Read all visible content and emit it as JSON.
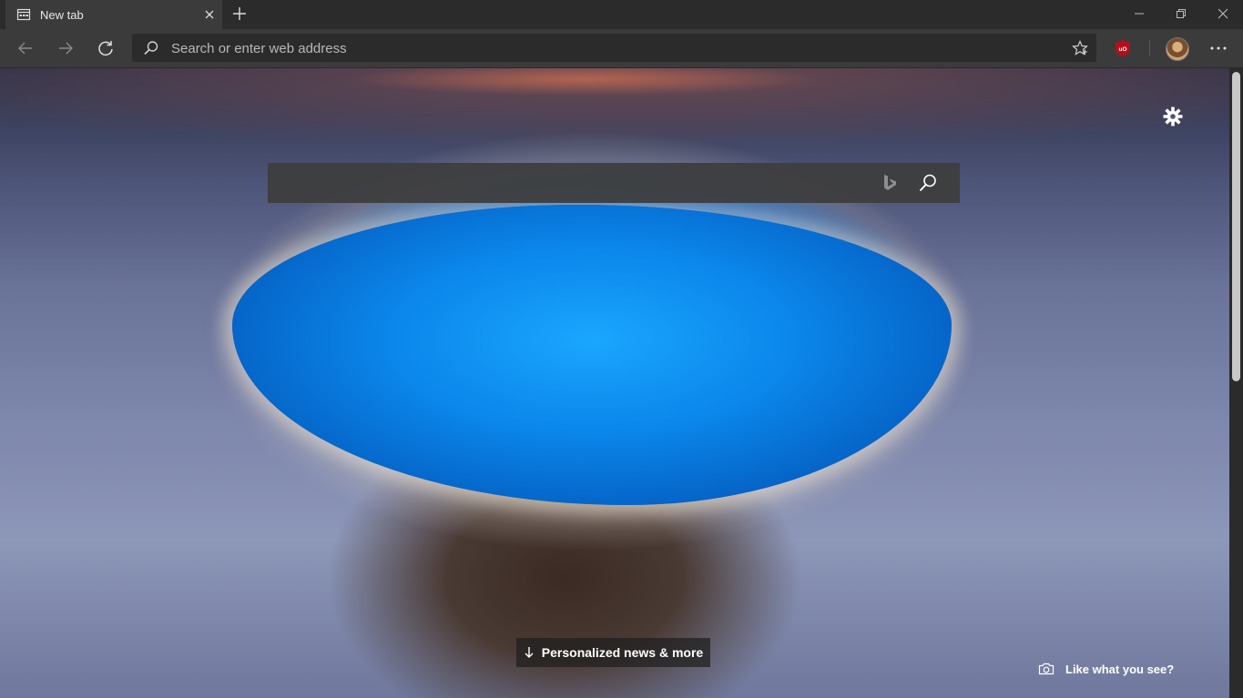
{
  "tab": {
    "title": "New tab",
    "favicon": "newtab-page-icon",
    "close_icon": "close-icon"
  },
  "window_controls": [
    "minimize-icon",
    "restore-icon",
    "close-icon"
  ],
  "toolbar": {
    "back_icon": "back-arrow-icon",
    "forward_icon": "forward-arrow-icon",
    "reload_icon": "refresh-icon",
    "address_placeholder": "Search or enter web address",
    "favorite_icon": "star-icon",
    "extension_icon": "ublock-origin-icon",
    "more_icon": "more-dots-icon"
  },
  "newtab": {
    "settings_icon": "gear-icon",
    "search_value": "",
    "bing_icon": "bing-logo-icon",
    "search_icon": "search-icon",
    "news_label": "Personalized news & more",
    "like_label": "Like what you see?"
  },
  "colors": {
    "toolbar": "#3b3b3b",
    "tabbar": "#2b2b2b",
    "address": "#2b2b2b",
    "ublock": "#b50f1c",
    "pool_blue": "#0b86ea"
  }
}
